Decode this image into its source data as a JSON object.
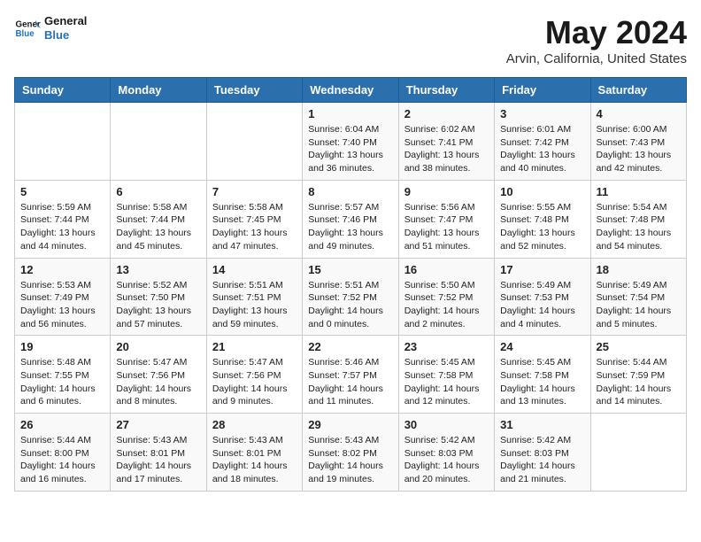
{
  "logo": {
    "line1": "General",
    "line2": "Blue"
  },
  "title": "May 2024",
  "subtitle": "Arvin, California, United States",
  "days_header": [
    "Sunday",
    "Monday",
    "Tuesday",
    "Wednesday",
    "Thursday",
    "Friday",
    "Saturday"
  ],
  "weeks": [
    [
      {
        "day": "",
        "info": ""
      },
      {
        "day": "",
        "info": ""
      },
      {
        "day": "",
        "info": ""
      },
      {
        "day": "1",
        "info": "Sunrise: 6:04 AM\nSunset: 7:40 PM\nDaylight: 13 hours\nand 36 minutes."
      },
      {
        "day": "2",
        "info": "Sunrise: 6:02 AM\nSunset: 7:41 PM\nDaylight: 13 hours\nand 38 minutes."
      },
      {
        "day": "3",
        "info": "Sunrise: 6:01 AM\nSunset: 7:42 PM\nDaylight: 13 hours\nand 40 minutes."
      },
      {
        "day": "4",
        "info": "Sunrise: 6:00 AM\nSunset: 7:43 PM\nDaylight: 13 hours\nand 42 minutes."
      }
    ],
    [
      {
        "day": "5",
        "info": "Sunrise: 5:59 AM\nSunset: 7:44 PM\nDaylight: 13 hours\nand 44 minutes."
      },
      {
        "day": "6",
        "info": "Sunrise: 5:58 AM\nSunset: 7:44 PM\nDaylight: 13 hours\nand 45 minutes."
      },
      {
        "day": "7",
        "info": "Sunrise: 5:58 AM\nSunset: 7:45 PM\nDaylight: 13 hours\nand 47 minutes."
      },
      {
        "day": "8",
        "info": "Sunrise: 5:57 AM\nSunset: 7:46 PM\nDaylight: 13 hours\nand 49 minutes."
      },
      {
        "day": "9",
        "info": "Sunrise: 5:56 AM\nSunset: 7:47 PM\nDaylight: 13 hours\nand 51 minutes."
      },
      {
        "day": "10",
        "info": "Sunrise: 5:55 AM\nSunset: 7:48 PM\nDaylight: 13 hours\nand 52 minutes."
      },
      {
        "day": "11",
        "info": "Sunrise: 5:54 AM\nSunset: 7:48 PM\nDaylight: 13 hours\nand 54 minutes."
      }
    ],
    [
      {
        "day": "12",
        "info": "Sunrise: 5:53 AM\nSunset: 7:49 PM\nDaylight: 13 hours\nand 56 minutes."
      },
      {
        "day": "13",
        "info": "Sunrise: 5:52 AM\nSunset: 7:50 PM\nDaylight: 13 hours\nand 57 minutes."
      },
      {
        "day": "14",
        "info": "Sunrise: 5:51 AM\nSunset: 7:51 PM\nDaylight: 13 hours\nand 59 minutes."
      },
      {
        "day": "15",
        "info": "Sunrise: 5:51 AM\nSunset: 7:52 PM\nDaylight: 14 hours\nand 0 minutes."
      },
      {
        "day": "16",
        "info": "Sunrise: 5:50 AM\nSunset: 7:52 PM\nDaylight: 14 hours\nand 2 minutes."
      },
      {
        "day": "17",
        "info": "Sunrise: 5:49 AM\nSunset: 7:53 PM\nDaylight: 14 hours\nand 4 minutes."
      },
      {
        "day": "18",
        "info": "Sunrise: 5:49 AM\nSunset: 7:54 PM\nDaylight: 14 hours\nand 5 minutes."
      }
    ],
    [
      {
        "day": "19",
        "info": "Sunrise: 5:48 AM\nSunset: 7:55 PM\nDaylight: 14 hours\nand 6 minutes."
      },
      {
        "day": "20",
        "info": "Sunrise: 5:47 AM\nSunset: 7:56 PM\nDaylight: 14 hours\nand 8 minutes."
      },
      {
        "day": "21",
        "info": "Sunrise: 5:47 AM\nSunset: 7:56 PM\nDaylight: 14 hours\nand 9 minutes."
      },
      {
        "day": "22",
        "info": "Sunrise: 5:46 AM\nSunset: 7:57 PM\nDaylight: 14 hours\nand 11 minutes."
      },
      {
        "day": "23",
        "info": "Sunrise: 5:45 AM\nSunset: 7:58 PM\nDaylight: 14 hours\nand 12 minutes."
      },
      {
        "day": "24",
        "info": "Sunrise: 5:45 AM\nSunset: 7:58 PM\nDaylight: 14 hours\nand 13 minutes."
      },
      {
        "day": "25",
        "info": "Sunrise: 5:44 AM\nSunset: 7:59 PM\nDaylight: 14 hours\nand 14 minutes."
      }
    ],
    [
      {
        "day": "26",
        "info": "Sunrise: 5:44 AM\nSunset: 8:00 PM\nDaylight: 14 hours\nand 16 minutes."
      },
      {
        "day": "27",
        "info": "Sunrise: 5:43 AM\nSunset: 8:01 PM\nDaylight: 14 hours\nand 17 minutes."
      },
      {
        "day": "28",
        "info": "Sunrise: 5:43 AM\nSunset: 8:01 PM\nDaylight: 14 hours\nand 18 minutes."
      },
      {
        "day": "29",
        "info": "Sunrise: 5:43 AM\nSunset: 8:02 PM\nDaylight: 14 hours\nand 19 minutes."
      },
      {
        "day": "30",
        "info": "Sunrise: 5:42 AM\nSunset: 8:03 PM\nDaylight: 14 hours\nand 20 minutes."
      },
      {
        "day": "31",
        "info": "Sunrise: 5:42 AM\nSunset: 8:03 PM\nDaylight: 14 hours\nand 21 minutes."
      },
      {
        "day": "",
        "info": ""
      }
    ]
  ]
}
